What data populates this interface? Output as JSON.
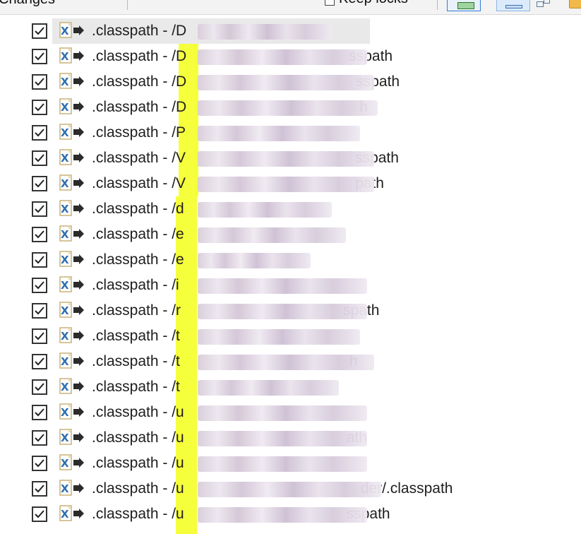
{
  "toolbar": {
    "title": "Changes",
    "keep_locks_label": "Keep locks"
  },
  "colors": {
    "highlight": "#f6ff3c",
    "selected_row": "#e9e9e9"
  },
  "rows": [
    {
      "prefix": ".classpath - ",
      "path_start": "/D",
      "path_end": ""
    },
    {
      "prefix": ".classpath - ",
      "path_start": "/D",
      "path_end": "sspath"
    },
    {
      "prefix": ".classpath - ",
      "path_start": "/D",
      "path_end": "sspath"
    },
    {
      "prefix": ".classpath - ",
      "path_start": "/D",
      "path_end": "h"
    },
    {
      "prefix": ".classpath - ",
      "path_start": "/P",
      "path_end": ""
    },
    {
      "prefix": ".classpath - ",
      "path_start": "/V",
      "path_end": "sspath"
    },
    {
      "prefix": ".classpath - ",
      "path_start": "/V",
      "path_end": "path"
    },
    {
      "prefix": ".classpath - ",
      "path_start": "/d",
      "path_end": ""
    },
    {
      "prefix": ".classpath - ",
      "path_start": "/e",
      "path_end": ""
    },
    {
      "prefix": ".classpath - ",
      "path_start": "/e",
      "path_end": ""
    },
    {
      "prefix": ".classpath - ",
      "path_start": "/i",
      "path_end": ""
    },
    {
      "prefix": ".classpath - ",
      "path_start": "/r",
      "path_end": "spath"
    },
    {
      "prefix": ".classpath - ",
      "path_start": "/t",
      "path_end": ""
    },
    {
      "prefix": ".classpath - ",
      "path_start": "/t",
      "path_end": "h"
    },
    {
      "prefix": ".classpath - ",
      "path_start": "/t",
      "path_end": ""
    },
    {
      "prefix": ".classpath - ",
      "path_start": "/u",
      "path_end": ""
    },
    {
      "prefix": ".classpath - ",
      "path_start": "/u",
      "path_end": "ath"
    },
    {
      "prefix": ".classpath - ",
      "path_start": "/u",
      "path_end": ""
    },
    {
      "prefix": ".classpath - ",
      "path_start": "/u",
      "path_end": "der/.classpath"
    },
    {
      "prefix": ".classpath - ",
      "path_start": "/u",
      "path_end": "sspath"
    }
  ]
}
